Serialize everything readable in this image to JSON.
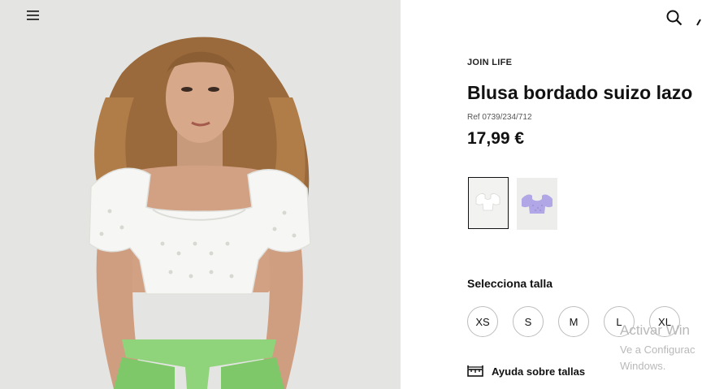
{
  "header": {
    "menu_icon": "hamburger-menu-icon",
    "search_icon": "search-icon",
    "account_icon": "user-icon"
  },
  "product": {
    "brand": "JOIN LIFE",
    "title": "Blusa bordado suizo lazo",
    "ref": "Ref 0739/234/712",
    "price": "17,99 €",
    "colors": [
      {
        "name": "white",
        "hex": "#ffffff",
        "selected": true
      },
      {
        "name": "lilac",
        "hex": "#b2a7e6",
        "selected": false
      }
    ]
  },
  "sizes": {
    "label": "Selecciona talla",
    "options": [
      "XS",
      "S",
      "M",
      "L",
      "XL"
    ]
  },
  "help": {
    "icon": "ruler-icon",
    "label": "Ayuda sobre tallas"
  },
  "watermark": {
    "line1": "Activar Win",
    "line2": "Ve a Configurac",
    "line3": "Windows."
  }
}
